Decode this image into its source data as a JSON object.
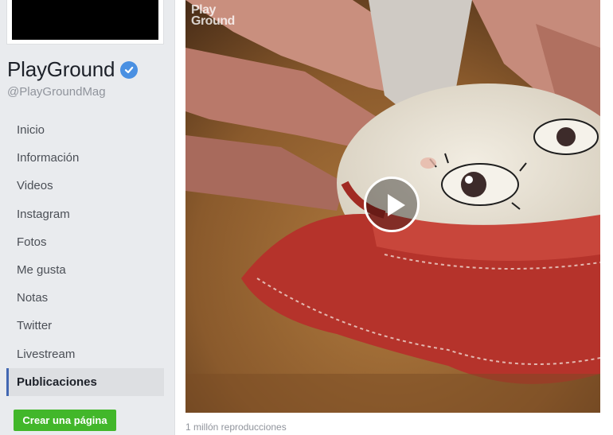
{
  "page": {
    "name": "PlayGround",
    "handle": "@PlayGroundMag",
    "verified": true,
    "accent_color": "#4267b2",
    "verified_color": "#4a90e2"
  },
  "nav": {
    "items": [
      {
        "label": "Inicio",
        "active": false
      },
      {
        "label": "Información",
        "active": false
      },
      {
        "label": "Videos",
        "active": false
      },
      {
        "label": "Instagram",
        "active": false
      },
      {
        "label": "Fotos",
        "active": false
      },
      {
        "label": "Me gusta",
        "active": false
      },
      {
        "label": "Notas",
        "active": false
      },
      {
        "label": "Twitter",
        "active": false
      },
      {
        "label": "Livestream",
        "active": false
      },
      {
        "label": "Publicaciones",
        "active": true
      }
    ]
  },
  "create_page_button": {
    "label": "Crear una página",
    "color": "#42b72a"
  },
  "post": {
    "video_watermark_line1": "Play",
    "video_watermark_line2": "Ground",
    "play_icon": "play-icon",
    "views": "1 millón reproducciones"
  }
}
